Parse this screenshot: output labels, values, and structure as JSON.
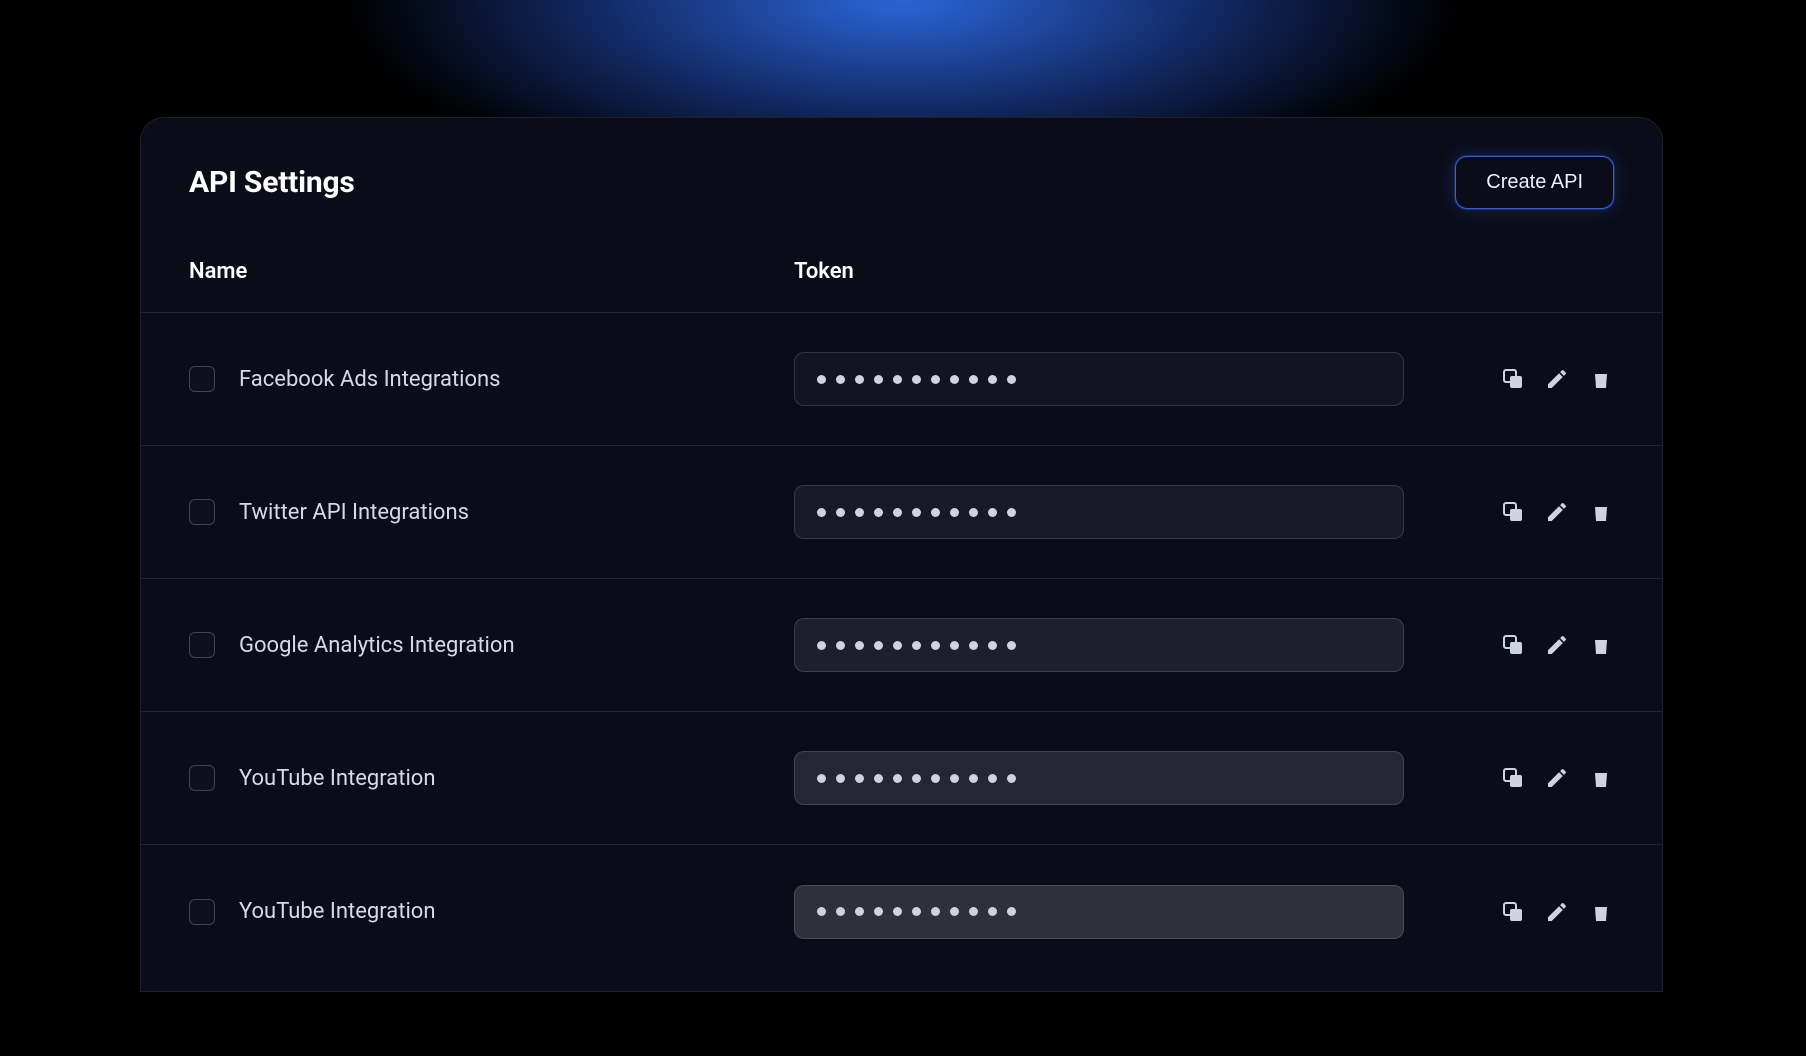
{
  "header": {
    "title": "API Settings",
    "create_label": "Create API"
  },
  "columns": {
    "name": "Name",
    "token": "Token"
  },
  "token_dot_count": 11,
  "rows": [
    {
      "name": "Facebook Ads Integrations",
      "checked": false,
      "token_bg": "token-bg-0"
    },
    {
      "name": "Twitter API Integrations",
      "checked": false,
      "token_bg": "token-bg-1"
    },
    {
      "name": "Google Analytics Integration",
      "checked": false,
      "token_bg": "token-bg-2"
    },
    {
      "name": "YouTube Integration",
      "checked": false,
      "token_bg": "token-bg-3"
    },
    {
      "name": "YouTube Integration",
      "checked": false,
      "token_bg": "token-bg-4"
    }
  ],
  "icons": {
    "copy": "copy-icon",
    "edit": "edit-icon",
    "delete": "delete-icon"
  }
}
